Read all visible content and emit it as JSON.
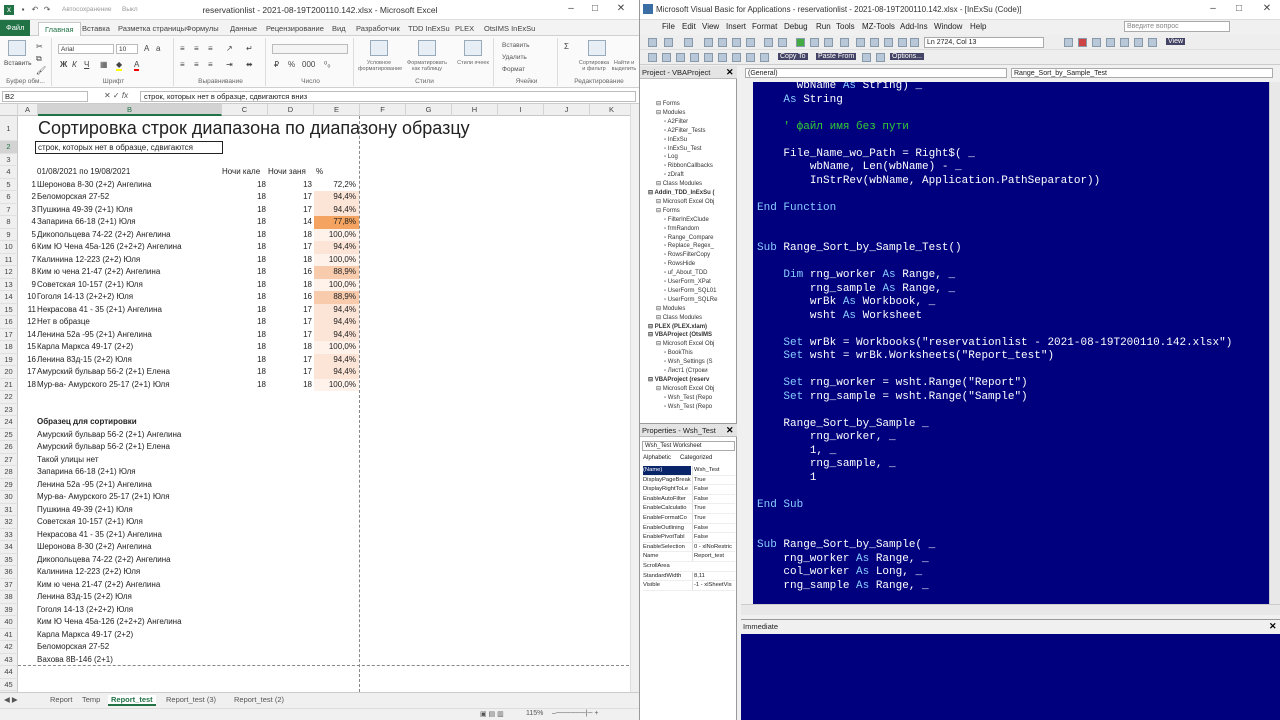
{
  "excel": {
    "title": "reservationlist - 2021-08-19T200110.142.xlsx  -  Microsoft Excel",
    "autosave": "Автосохранение",
    "autosave_state": "Выкл",
    "tabs": [
      "Файл",
      "Главная",
      "Вставка",
      "Разметка страницы",
      "Формулы",
      "Данные",
      "Рецензирование",
      "Вид",
      "Разработчик",
      "TDD InExSu",
      "PLEX",
      "OtsIMS InExSu"
    ],
    "ribbon": {
      "paste": "Вставить",
      "clipboard": "Буфер обм...",
      "font_name": "Arial",
      "font_size": "10",
      "font": "Шрифт",
      "alignment": "Выравнивание",
      "number": "Число",
      "styles": "Стили",
      "cond_format": "Условное форматирование",
      "format_table": "Форматировать как таблицу",
      "cell_styles": "Стили ячеек",
      "insert": "Вставить",
      "delete": "Удалить",
      "format": "Формат",
      "cells": "Ячейки",
      "sort_filter": "Сортировка и фильтр",
      "find_select": "Найти и выделить",
      "editing": "Редактирование"
    },
    "name_box": "B2",
    "formula": "строк, которых нет в образце, сдвигаются вниз",
    "columns": [
      "A",
      "B",
      "C",
      "D",
      "E",
      "F",
      "G",
      "H",
      "I",
      "J",
      "K"
    ],
    "rows": [
      {
        "n": "1",
        "b": "Сортировка строк диапазона по диапазону образцу"
      },
      {
        "n": "2",
        "b": "строк, которых нет в образце, сдвигаются"
      },
      {
        "n": "3"
      },
      {
        "n": "4",
        "b": "01/08/2021 по 19/08/2021",
        "c": "Ночи кале",
        "d": "Ночи заня",
        "e": "%"
      },
      {
        "n": "5",
        "a": "1",
        "b": "Шеронова 8-30 (2+2) Ангелина",
        "c": "18",
        "d": "13",
        "e": "72,2%"
      },
      {
        "n": "6",
        "a": "2",
        "b": "Беломорская 27-52",
        "c": "18",
        "d": "17",
        "e": "94,4%"
      },
      {
        "n": "7",
        "a": "3",
        "b": "Пушкина 49-39  (2+1) Юля",
        "c": "18",
        "d": "17",
        "e": "94,4%"
      },
      {
        "n": "8",
        "a": "4",
        "b": "Запарина 66-18 (2+1) Юля",
        "c": "18",
        "d": "14",
        "e": "77,8%"
      },
      {
        "n": "9",
        "a": "5",
        "b": "Дикопольцева 74-22 (2+2) Ангелина",
        "c": "18",
        "d": "18",
        "e": "100,0%"
      },
      {
        "n": "10",
        "a": "6",
        "b": "Ким Ю Чена 45а-126 (2+2+2)  Ангелина",
        "c": "18",
        "d": "17",
        "e": "94,4%"
      },
      {
        "n": "11",
        "a": "7",
        "b": "Калинина 12-223 (2+2) Юля",
        "c": "18",
        "d": "18",
        "e": "100,0%"
      },
      {
        "n": "12",
        "a": "8",
        "b": "Ким ю чена  21-47  (2+2) Ангелина",
        "c": "18",
        "d": "16",
        "e": "88,9%"
      },
      {
        "n": "13",
        "a": "9",
        "b": "Советская 10-157 (2+1) Юля",
        "c": "18",
        "d": "18",
        "e": "100,0%"
      },
      {
        "n": "14",
        "a": "10",
        "b": "Гоголя 14-13 (2+2+2) Юля",
        "c": "18",
        "d": "16",
        "e": "88,9%"
      },
      {
        "n": "15",
        "a": "11",
        "b": "Некрасова 41 - 35 (2+1) Ангелина",
        "c": "18",
        "d": "17",
        "e": "94,4%"
      },
      {
        "n": "16",
        "a": "12",
        "b": "Нет в образце",
        "c": "18",
        "d": "17",
        "e": "94,4%"
      },
      {
        "n": "17",
        "a": "14",
        "b": "Ленина 52а -95 (2+1) Ангелина",
        "c": "18",
        "d": "17",
        "e": "94,4%"
      },
      {
        "n": "18",
        "a": "15",
        "b": "Карла Маркса 49-17 (2+2)",
        "c": "18",
        "d": "18",
        "e": "100,0%"
      },
      {
        "n": "19",
        "a": "16",
        "b": "Ленина 83д-15 (2+2) Юля",
        "c": "18",
        "d": "17",
        "e": "94,4%"
      },
      {
        "n": "20",
        "a": "17",
        "b": "Амурский бульвар 56-2 (2+1) Елена",
        "c": "18",
        "d": "17",
        "e": "94,4%"
      },
      {
        "n": "21",
        "a": "18",
        "b": "Мур-ва- Амурского 25-17 (2+1) Юля",
        "c": "18",
        "d": "18",
        "e": "100,0%"
      },
      {
        "n": "22"
      },
      {
        "n": "23"
      },
      {
        "n": "24",
        "b": "Образец для сортировки"
      },
      {
        "n": "25",
        "b": "Амурский бульвар 56-2 (2+1) Ангелина"
      },
      {
        "n": "26",
        "b": "Амурский бульвар 56-2 (2+1) Елена"
      },
      {
        "n": "27",
        "b": "Такой улицы нет"
      },
      {
        "n": "28",
        "b": "Запарина 66-18 (2+1) Юля"
      },
      {
        "n": "29",
        "b": "Ленина 52а -95 (2+1) Ангелина"
      },
      {
        "n": "30",
        "b": "Мур-ва- Амурского 25-17 (2+1) Юля"
      },
      {
        "n": "31",
        "b": "Пушкина 49-39  (2+1) Юля"
      },
      {
        "n": "32",
        "b": "Советская 10-157 (2+1) Юля"
      },
      {
        "n": "33",
        "b": "Некрасова 41 - 35 (2+1) Ангелина"
      },
      {
        "n": "34",
        "b": "Шеронова 8-30 (2+2) Ангелина"
      },
      {
        "n": "35",
        "b": "Дикопольцева 74-22 (2+2) Ангелина"
      },
      {
        "n": "36",
        "b": "Калинина 12-223 (2+2) Юля"
      },
      {
        "n": "37",
        "b": "Ким ю чена  21-47  (2+2) Ангелина"
      },
      {
        "n": "38",
        "b": "Ленина 83д-15 (2+2) Юля"
      },
      {
        "n": "39",
        "b": "Гоголя 14-13 (2+2+2) Юля"
      },
      {
        "n": "40",
        "b": "Ким Ю Чена 45а-126 (2+2+2)  Ангелина"
      },
      {
        "n": "41",
        "b": "Карла Маркса 49-17 (2+2)"
      },
      {
        "n": "42",
        "b": "Беломорская 27-52"
      },
      {
        "n": "43",
        "b": "Вахова 8В-146 (2+1)"
      },
      {
        "n": "44"
      },
      {
        "n": "45"
      },
      {
        "n": "46"
      }
    ],
    "cell_colors": {
      "72,2%": "#ffffff",
      "77,8%": "#f4a460",
      "88,9%": "#f8cbad",
      "94,4%": "#fce4d6",
      "100,0%": "#fff2ea"
    },
    "sheets": [
      "Report",
      "Temp",
      "Report_test",
      "Report_test (3)",
      "Report_test (2)"
    ],
    "active_sheet": "Report_test",
    "zoom": "115%"
  },
  "vbe": {
    "title": "Microsoft Visual Basic for Applications - reservationlist - 2021-08-19T200110.142.xlsx - [InExSu (Code)]",
    "menu": [
      "File",
      "Edit",
      "View",
      "Insert",
      "Format",
      "Debug",
      "Run",
      "Tools",
      "MZ-Tools",
      "Add-Ins",
      "Window",
      "Help"
    ],
    "help_placeholder": "Введите вопрос",
    "position": "Ln 2724, Col 13",
    "copy_to": "Copy To",
    "paste_from": "Paste From",
    "view_btn": "View",
    "options": "Options...",
    "project_title": "Project - VBAProject",
    "tree": [
      {
        "t": "Forms",
        "b": false
      },
      {
        "t": "Modules",
        "b": false
      },
      {
        "t": "A2Filter",
        "b": false
      },
      {
        "t": "A2Filter_Tests",
        "b": false
      },
      {
        "t": "InExSu",
        "b": false
      },
      {
        "t": "InExSu_Test",
        "b": false
      },
      {
        "t": "Log",
        "b": false
      },
      {
        "t": "RibbonCallbacks",
        "b": false
      },
      {
        "t": "zDraft",
        "b": false
      },
      {
        "t": "Class Modules",
        "b": false
      },
      {
        "t": "Addin_TDD_InExSu (",
        "b": true
      },
      {
        "t": "Microsoft Excel Obj",
        "b": false
      },
      {
        "t": "Forms",
        "b": false
      },
      {
        "t": "FilterInExClude",
        "b": false
      },
      {
        "t": "frmRandom",
        "b": false
      },
      {
        "t": "Range_Compare",
        "b": false
      },
      {
        "t": "Replace_Regex_",
        "b": false
      },
      {
        "t": "RowsFilterCopy",
        "b": false
      },
      {
        "t": "RowsHide",
        "b": false
      },
      {
        "t": "uf_About_TDD",
        "b": false
      },
      {
        "t": "UserForm_XPat",
        "b": false
      },
      {
        "t": "UserForm_SQL01",
        "b": false
      },
      {
        "t": "UserForm_SQLRe",
        "b": false
      },
      {
        "t": "Modules",
        "b": false
      },
      {
        "t": "Class Modules",
        "b": false
      },
      {
        "t": "PLEX (PLEX.xlam)",
        "b": true
      },
      {
        "t": "VBAProject (OtsIMS",
        "b": true
      },
      {
        "t": "Microsoft Excel Obj",
        "b": false
      },
      {
        "t": "BookThis",
        "b": false
      },
      {
        "t": "Wsh_Settings (S",
        "b": false
      },
      {
        "t": "Лист1 (Строки",
        "b": false
      },
      {
        "t": "VBAProject (reserv",
        "b": true
      },
      {
        "t": "Microsoft Excel Obj",
        "b": false
      },
      {
        "t": "Wsh_Test (Repo",
        "b": false
      },
      {
        "t": "Wsh_Test (Repo",
        "b": false
      }
    ],
    "props_title": "Properties - Wsh_Test",
    "props_combo": "Wsh_Test Worksheet",
    "props_tabs": [
      "Alphabetic",
      "Categorized"
    ],
    "props": [
      [
        "(Name)",
        "Wsh_Test"
      ],
      [
        "DisplayPageBreak",
        "True"
      ],
      [
        "DisplayRightToLe",
        "False"
      ],
      [
        "EnableAutoFilter",
        "False"
      ],
      [
        "EnableCalculatio",
        "True"
      ],
      [
        "EnableFormatCo",
        "True"
      ],
      [
        "EnableOutlining",
        "False"
      ],
      [
        "EnablePivotTabl",
        "False"
      ],
      [
        "EnableSelection",
        "0 - xlNoRestric"
      ],
      [
        "Name",
        "Report_test"
      ],
      [
        "ScrollArea",
        ""
      ],
      [
        "StandardWidth",
        "8,11"
      ],
      [
        "Visible",
        "-1 - xlSheetVis"
      ]
    ],
    "combo_general": "(General)",
    "combo_proc": "Range_Sort_by_Sample_Test",
    "code": [
      {
        "i": "   ",
        "p": [
          [
            "n",
            "wbName "
          ],
          [
            "k",
            "As"
          ],
          [
            "n",
            " String) _"
          ]
        ]
      },
      {
        "i": "  ",
        "p": [
          [
            "k",
            "As"
          ],
          [
            "n",
            " String"
          ]
        ]
      },
      {
        "i": "",
        "p": []
      },
      {
        "i": "  ",
        "p": [
          [
            "c",
            "' файл имя без пути"
          ]
        ]
      },
      {
        "i": "",
        "p": []
      },
      {
        "i": "  ",
        "p": [
          [
            "n",
            "File_Name_wo_Path = Right$( _"
          ]
        ]
      },
      {
        "i": "    ",
        "p": [
          [
            "n",
            "wbName, Len(wbName) - _"
          ]
        ]
      },
      {
        "i": "    ",
        "p": [
          [
            "n",
            "InStrRev(wbName, Application.PathSeparator))"
          ]
        ]
      },
      {
        "i": "",
        "p": []
      },
      {
        "i": "",
        "p": [
          [
            "k",
            "End Function"
          ]
        ]
      },
      {
        "i": "",
        "p": []
      },
      {
        "i": "",
        "p": []
      },
      {
        "i": "",
        "p": [
          [
            "k",
            "Sub"
          ],
          [
            "n",
            " Range_Sort_by_Sample_Test()"
          ]
        ]
      },
      {
        "i": "",
        "p": []
      },
      {
        "i": "  ",
        "p": [
          [
            "k",
            "Dim"
          ],
          [
            "n",
            " rng_worker "
          ],
          [
            "k",
            "As"
          ],
          [
            "n",
            " Range, _"
          ]
        ]
      },
      {
        "i": "    ",
        "p": [
          [
            "n",
            "rng_sample "
          ],
          [
            "k",
            "As"
          ],
          [
            "n",
            " Range, _"
          ]
        ]
      },
      {
        "i": "    ",
        "p": [
          [
            "n",
            "wrBk "
          ],
          [
            "k",
            "As"
          ],
          [
            "n",
            " Workbook, _"
          ]
        ]
      },
      {
        "i": "    ",
        "p": [
          [
            "n",
            "wsht "
          ],
          [
            "k",
            "As"
          ],
          [
            "n",
            " Worksheet"
          ]
        ]
      },
      {
        "i": "",
        "p": []
      },
      {
        "i": "  ",
        "p": [
          [
            "k",
            "Set"
          ],
          [
            "n",
            " wrBk = Workbooks(\"reservationlist - 2021-08-19T200110.142.xlsx\")"
          ]
        ]
      },
      {
        "i": "  ",
        "p": [
          [
            "k",
            "Set"
          ],
          [
            "n",
            " wsht = wrBk.Worksheets(\"Report_test\")"
          ]
        ]
      },
      {
        "i": "",
        "p": []
      },
      {
        "i": "  ",
        "p": [
          [
            "k",
            "Set"
          ],
          [
            "n",
            " rng_worker = wsht.Range(\"Report\")"
          ]
        ]
      },
      {
        "i": "  ",
        "p": [
          [
            "k",
            "Set"
          ],
          [
            "n",
            " rng_sample = wsht.Range(\"Sample\")"
          ]
        ]
      },
      {
        "i": "",
        "p": []
      },
      {
        "i": "  ",
        "p": [
          [
            "n",
            "Range_Sort_by_Sample _"
          ]
        ]
      },
      {
        "i": "    ",
        "p": [
          [
            "n",
            "rng_worker, _"
          ]
        ]
      },
      {
        "i": "    ",
        "p": [
          [
            "n",
            "1, _"
          ]
        ]
      },
      {
        "i": "    ",
        "p": [
          [
            "n",
            "rng_sample, _"
          ]
        ]
      },
      {
        "i": "    ",
        "p": [
          [
            "n",
            "1"
          ]
        ]
      },
      {
        "i": "",
        "p": []
      },
      {
        "i": "",
        "p": [
          [
            "k",
            "End Sub"
          ]
        ]
      },
      {
        "i": "",
        "p": []
      },
      {
        "i": "",
        "p": []
      },
      {
        "i": "",
        "p": [
          [
            "k",
            "Sub"
          ],
          [
            "n",
            " Range_Sort_by_Sample( _"
          ]
        ]
      },
      {
        "i": "  ",
        "p": [
          [
            "n",
            "rng_worker "
          ],
          [
            "k",
            "As"
          ],
          [
            "n",
            " Range, _"
          ]
        ]
      },
      {
        "i": "  ",
        "p": [
          [
            "n",
            "col_worker "
          ],
          [
            "k",
            "As"
          ],
          [
            "n",
            " Long, _"
          ]
        ]
      },
      {
        "i": "  ",
        "p": [
          [
            "n",
            "rng_sample "
          ],
          [
            "k",
            "As"
          ],
          [
            "n",
            " Range, _"
          ]
        ]
      }
    ],
    "immediate_title": "Immediate"
  }
}
